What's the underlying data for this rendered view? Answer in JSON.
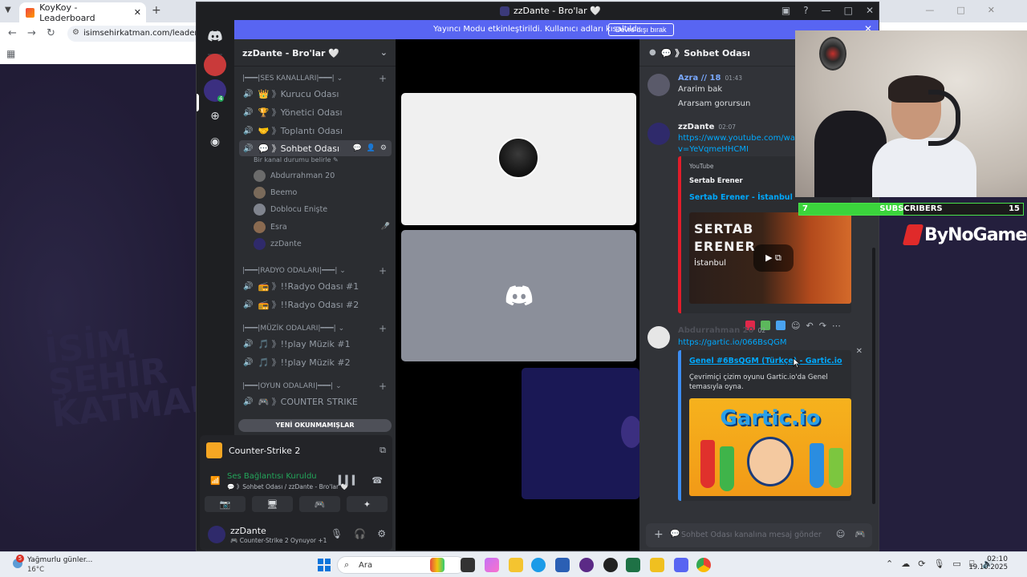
{
  "browser": {
    "tab_title": "KoyKoy - Leaderboard",
    "url": "isimsehirkatman.com/leaderboard",
    "watermark": "İsim Şehir Katman"
  },
  "discord": {
    "window_title": "zzDante - Bro'lar 🤍",
    "streamer_mode_text": "Yayıncı Modu etkinleştirildi. Kullanıcı adları kısaltıldı.",
    "streamer_mode_button": "Devre dışı bırak",
    "server_name": "zzDante - Bro'lar 🤍",
    "categories": {
      "ses": "|━━━|SES KANALLARI|━━━|",
      "radyo": "|━━━|RADYO ODALARI|━━━|",
      "muzik": "|━━━|MÜZİK ODALARI|━━━|",
      "oyun": "|━━━|OYUN ODALARI|━━━|"
    },
    "channels": {
      "kurucu": "👑 》Kurucu Odası",
      "yonetici": "🏆 》Yönetici Odası",
      "toplanti": "🤝 》Toplantı Odası",
      "sohbet": "💬 》Sohbet Odası",
      "sohbet_status": "Bir kanal durumu belirle ✎",
      "radyo1": "📻 》!!Radyo Odası #1",
      "radyo2": "📻 》!!Radyo Odası #2",
      "muzik1": "🎵 》!!play Müzik #1",
      "muzik2": "🎵 》!!play Müzik #2",
      "cs": "🎮 》COUNTER STRIKE"
    },
    "voice_users": [
      "Abdurrahman 20",
      "Beemo",
      "Doblocu Enişte",
      "Esra",
      "zzDante"
    ],
    "unread_pill": "YENİ OKUNMAMIŞLAR",
    "activity_game": "Counter-Strike 2",
    "voice_status": "Ses Bağlantısı Kuruldu",
    "voice_location": "💬 》Sohbet Odası / zzDante - Bro'lar 🤍",
    "me_name": "zzDante",
    "me_activity": "🎮 Counter-Strike 2 Oynuyor +1",
    "rail_badge": "4",
    "chat": {
      "channel": "💬 》Sohbet Odası",
      "m1_name": "Azra // 18",
      "m1_time": "01:43",
      "m1_line1": "Ararim bak",
      "m1_line2": "Ararsam gorursun",
      "m2_name": "zzDante",
      "m2_time": "02:07",
      "m2_link": "https://www.youtube.com/watch?v=YeVqmeHHCMI",
      "yt_provider": "YouTube",
      "yt_author": "Sertab Erener",
      "yt_title": "Sertab Erener - İstanbul",
      "yt_thumb_line1": "SERTAB",
      "yt_thumb_line2": "ERENER",
      "yt_thumb_line3": "İstanbul",
      "m3_name": "Abdurrahman 20",
      "m3_time": "02",
      "m3_link": "https://gartic.io/066BsQGM",
      "gartic_title": "Genel #6BsQGM (Türkçe) - Gartic.io",
      "gartic_desc": "Çevrimiçi çizim oyunu Gartic.io'da Genel temasıyla oyna.",
      "gartic_logo": "Gartic.io",
      "input_placeholder": "Sohbet Odası kanalına mesaj gönder"
    }
  },
  "overlay": {
    "subs_left": "7",
    "subs_label": "SUBSCRIBERS",
    "subs_right": "15",
    "subs_fraction": 0.4667,
    "brand": "ByNoGame"
  },
  "taskbar": {
    "weather_title": "Yağmurlu günler...",
    "weather_temp": "16°C",
    "weather_badge": "5",
    "search": "Ara",
    "time": "02:10",
    "date": "19.10.2025"
  },
  "colors": {
    "discord_blurple": "#5865f2",
    "discord_green": "#23a55a",
    "link": "#00a8fc",
    "youtube_embed": "#e11d2a",
    "gartic_embed": "#3c8df2",
    "subs_green": "#3bd43c"
  }
}
